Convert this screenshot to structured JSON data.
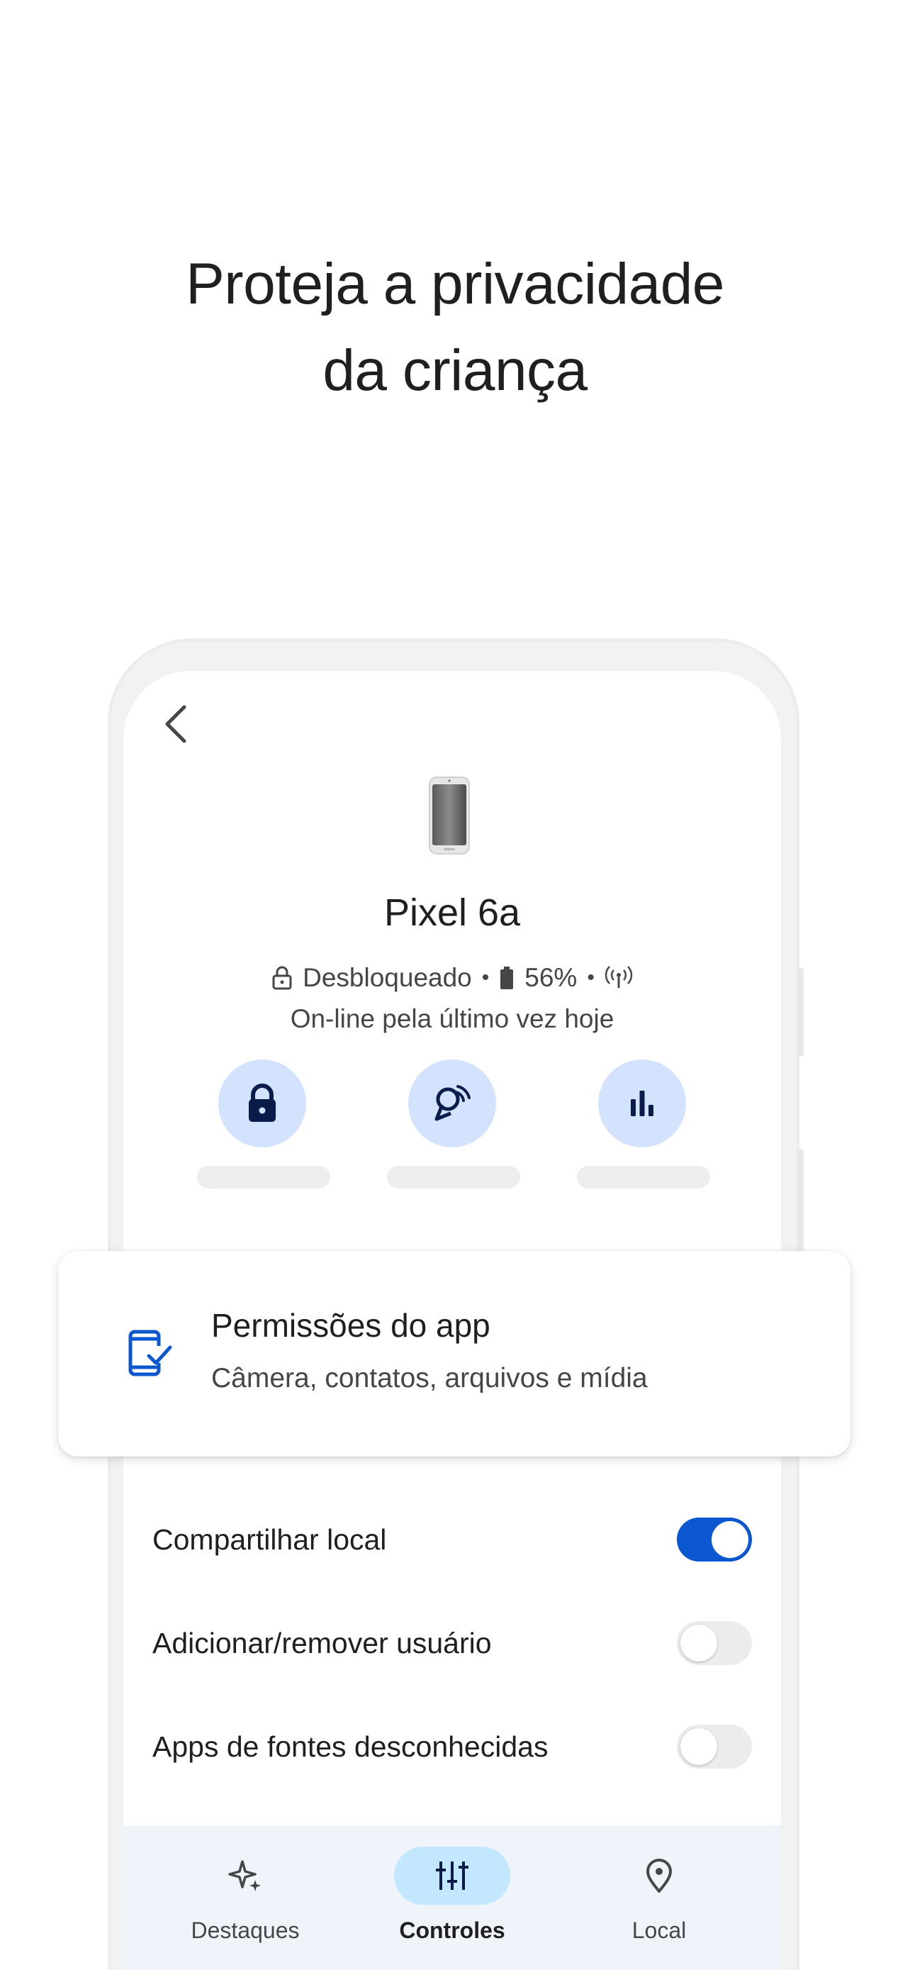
{
  "headline": {
    "line1": "Proteja a privacidade",
    "line2": "da criança"
  },
  "device": {
    "name": "Pixel 6a",
    "lock_status": "Desbloqueado",
    "battery": "56%",
    "last_online": "On-line pela último vez hoje"
  },
  "actions": [
    {
      "icon": "lock-icon"
    },
    {
      "icon": "ring-device-icon"
    },
    {
      "icon": "bar-chart-icon"
    }
  ],
  "permissions_card": {
    "icon": "app-permissions-icon",
    "title": "Permissões do app",
    "subtitle": "Câmera, contatos, arquivos e mídia"
  },
  "toggles": [
    {
      "label": "Compartilhar local",
      "on": true
    },
    {
      "label": "Adicionar/remover usuário",
      "on": false
    },
    {
      "label": "Apps de fontes desconhecidas",
      "on": false
    }
  ],
  "bottom_nav": [
    {
      "label": "Destaques",
      "icon": "sparkle-icon",
      "active": false
    },
    {
      "label": "Controles",
      "icon": "tune-icon",
      "active": true
    },
    {
      "label": "Local",
      "icon": "location-pin-icon",
      "active": false
    }
  ],
  "colors": {
    "accent": "#0b57d0",
    "action_bg": "#d3e3fd",
    "nav_active_bg": "#c2e7ff",
    "nav_bg": "#eff3fa"
  }
}
